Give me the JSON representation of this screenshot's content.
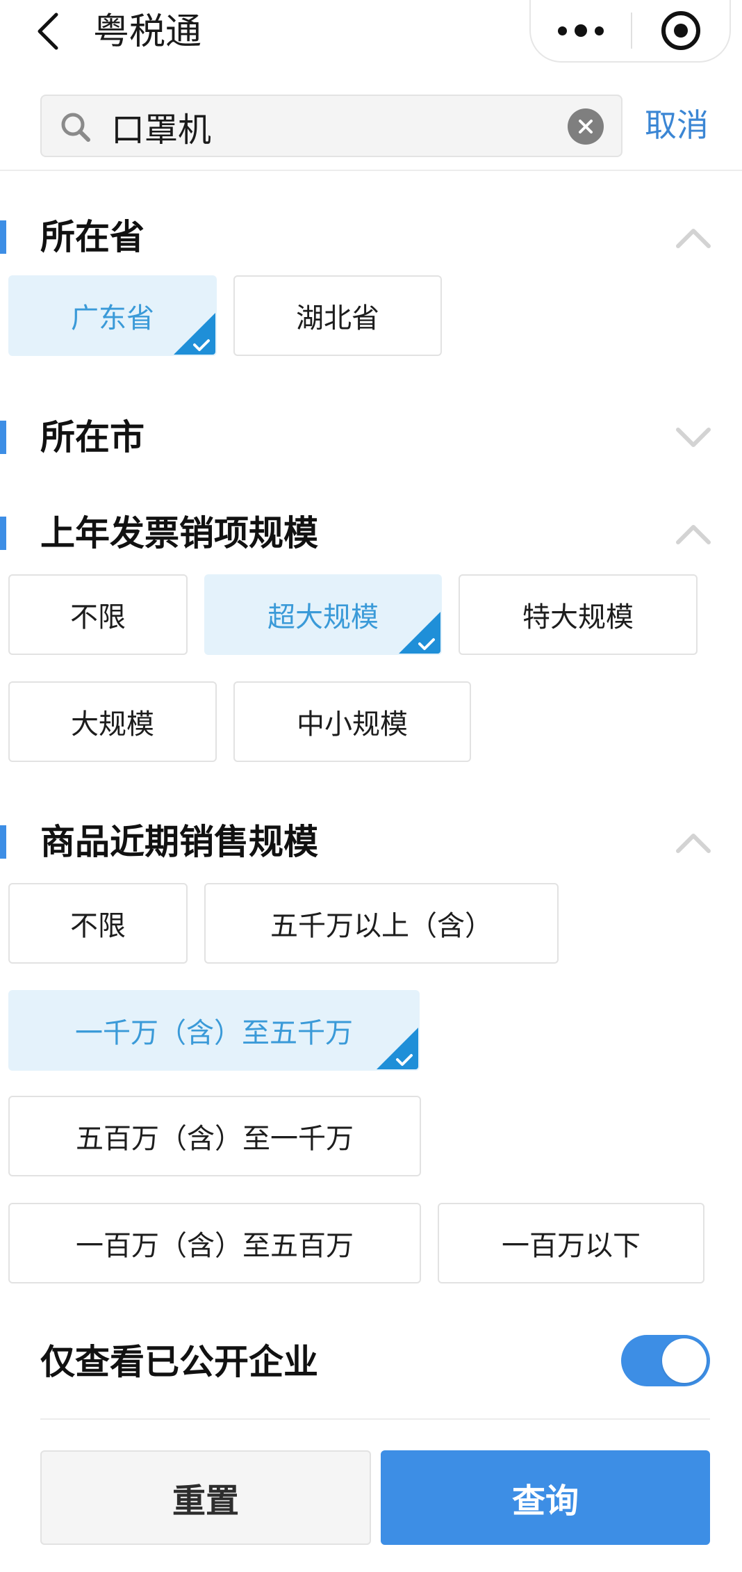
{
  "nav": {
    "title": "粤税通",
    "icons": {
      "back": "back-arrow-icon",
      "more": "more-dots-icon",
      "close": "close-miniprogram-icon"
    }
  },
  "search": {
    "value": "口罩机",
    "placeholder": "",
    "cancel_label": "取消",
    "icons": {
      "search": "search-icon",
      "clear": "clear-icon"
    }
  },
  "sections": {
    "province": {
      "title": "所在省",
      "expanded": true,
      "options": [
        {
          "label": "广东省",
          "selected": true
        },
        {
          "label": "湖北省",
          "selected": false
        }
      ]
    },
    "city": {
      "title": "所在市",
      "expanded": false
    },
    "invoice_scale": {
      "title": "上年发票销项规模",
      "expanded": true,
      "options": [
        {
          "label": "不限",
          "selected": false
        },
        {
          "label": "超大规模",
          "selected": true
        },
        {
          "label": "特大规模",
          "selected": false
        },
        {
          "label": "大规模",
          "selected": false
        },
        {
          "label": "中小规模",
          "selected": false
        }
      ]
    },
    "recent_sales": {
      "title": "商品近期销售规模",
      "expanded": true,
      "options": [
        {
          "label": "不限",
          "selected": false
        },
        {
          "label": "五千万以上（含）",
          "selected": false
        },
        {
          "label": "一千万（含）至五千万",
          "selected": true
        },
        {
          "label": "五百万（含）至一千万",
          "selected": false
        },
        {
          "label": "一百万（含）至五百万",
          "selected": false
        },
        {
          "label": "一百万以下",
          "selected": false
        }
      ]
    }
  },
  "toggle": {
    "label": "仅查看已公开企业",
    "on": true
  },
  "buttons": {
    "reset": "重置",
    "query": "查询"
  },
  "colors": {
    "accent": "#3d8ee5",
    "selected_bg": "#e4f2fb",
    "selected_text": "#3a9ad8",
    "cancel_text": "#3b86d4"
  }
}
